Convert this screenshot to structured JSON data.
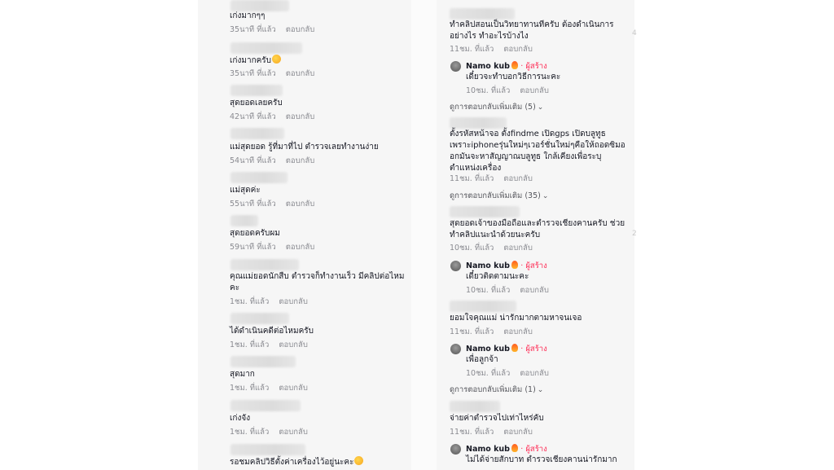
{
  "left_comments": [
    {
      "text": "เก่งมากๆๆ",
      "time": "35นาที ที่แล้ว",
      "reply": "ตอบกลับ"
    },
    {
      "text": "เก่งมากครับ",
      "emoji": true,
      "time": "35นาที ที่แล้ว",
      "reply": "ตอบกลับ"
    },
    {
      "text": "สุดยอดเลยครับ",
      "time": "42นาที ที่แล้ว",
      "reply": "ตอบกลับ"
    },
    {
      "text": "แม่สุดยอด รู้ที่มาที่ไป ตำรวจเลยทำงานง่าย",
      "time": "54นาที ที่แล้ว",
      "reply": "ตอบกลับ"
    },
    {
      "text": "แม่สุดค่ะ",
      "time": "55นาที ที่แล้ว",
      "reply": "ตอบกลับ"
    },
    {
      "text": "สุดยอดครับผม",
      "time": "59นาที ที่แล้ว",
      "reply": "ตอบกลับ"
    },
    {
      "text": "คุณแม่ยอดนักสืบ ตำรวจก็ทำงานเร็ว มีคลิปต่อไหม\nคะ",
      "time": "1ชม. ที่แล้ว",
      "reply": "ตอบกลับ"
    },
    {
      "text": "ได้ดำเนินคดีต่อไหมครับ",
      "time": "1ชม. ที่แล้ว",
      "reply": "ตอบกลับ"
    },
    {
      "text": "สุดมาก",
      "time": "1ชม. ที่แล้ว",
      "reply": "ตอบกลับ"
    },
    {
      "text": "เก่งจัง",
      "time": "1ชม. ที่แล้ว",
      "reply": "ตอบกลับ"
    },
    {
      "text": "รอชมคลิปวิธีตั้งค่าเครื่องไว้อยู่นะคะ",
      "emoji": true
    }
  ],
  "right_comments": [
    {
      "text": "ทำคลิปสอนเป็นวิทยาทานทีครับ ต้องดำเนินการ\nอย่างไร ทำอะไรบ้างไง",
      "time": "11ชม. ที่แล้ว",
      "reply": "ตอบกลับ",
      "creator_reply": {
        "author": "Namo kub",
        "badge": "· ผู้สร้าง",
        "text": "เดี๋ยวจะทำบอกวิธีการนะคะ",
        "time": "10ชม. ที่แล้ว",
        "reply": "ตอบกลับ"
      },
      "view_more": "ดูการตอบกลับเพิ่มเติม (5)"
    },
    {
      "text": "ตั้งรหัสหน้าจอ ตั้งfindme เปิดgps เปิดบลูทูธ\nเพราะiphoneรุ่นใหม่ๆเวอร์ชั่นใหม่ๆคือให้ถอดซิมอ\nอกมันจะหาสัญญาณบลูทูธ ใกล้เคียงเพื่อระบุ\nตำแหน่งเครื่อง",
      "time": "11ชม. ที่แล้ว",
      "reply": "ตอบกลับ",
      "view_more": "ดูการตอบกลับเพิ่มเติม (35)"
    },
    {
      "text": "สุดยอดเจ้าของมือถือและตำรวจเชียงคานครับ ช่วย\nทำคลิปแนะนำด้วยนะครับ",
      "time": "10ชม. ที่แล้ว",
      "reply": "ตอบกลับ",
      "creator_reply": {
        "author": "Namo kub",
        "badge": "· ผู้สร้าง",
        "text": "เดี๋ยวติดตามนะคะ",
        "time": "10ชม. ที่แล้ว",
        "reply": "ตอบกลับ"
      }
    },
    {
      "text": "ยอมใจคุณแม่ น่ารักมากตามหาจนเจอ",
      "time": "11ชม. ที่แล้ว",
      "reply": "ตอบกลับ",
      "creator_reply": {
        "author": "Namo kub",
        "badge": "· ผู้สร้าง",
        "text": "เพื่อลูกจ้า",
        "time": "10ชม. ที่แล้ว",
        "reply": "ตอบกลับ"
      },
      "view_more": "ดูการตอบกลับเพิ่มเติม (1)"
    },
    {
      "text": "จ่ายค่าตำรวจไปเท่าไหร่คับ",
      "time": "11ชม. ที่แล้ว",
      "reply": "ตอบกลับ",
      "creator_reply": {
        "author": "Namo kub",
        "badge": "· ผู้สร้าง",
        "text": "ไม่ได้จ่ายสักบาท ตำรวจเชียงคานน่ารักมาก"
      }
    }
  ],
  "edge_marks": [
    "4",
    "2"
  ],
  "colors": {
    "creator": "#fe2c55",
    "meta": "#8a8b91",
    "panel": "#f6f6f6"
  }
}
